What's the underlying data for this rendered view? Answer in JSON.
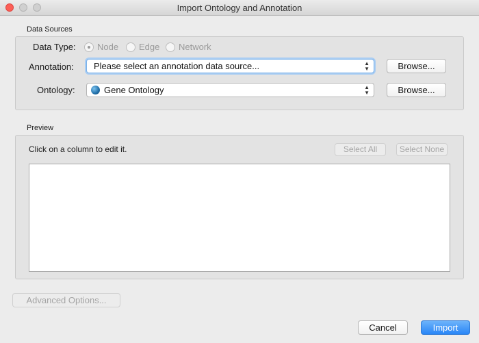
{
  "window": {
    "title": "Import Ontology and Annotation"
  },
  "data_sources": {
    "group_label": "Data Sources",
    "data_type_label": "Data Type:",
    "data_type_options": [
      "Node",
      "Edge",
      "Network"
    ],
    "data_type_selected": "Node",
    "annotation_label": "Annotation:",
    "annotation_value": "Please select an annotation data source...",
    "annotation_browse": "Browse...",
    "ontology_label": "Ontology:",
    "ontology_value": "Gene Ontology",
    "ontology_browse": "Browse..."
  },
  "preview": {
    "group_label": "Preview",
    "hint": "Click on a column to edit it.",
    "select_all": "Select All",
    "select_none": "Select None"
  },
  "footer": {
    "advanced": "Advanced Options...",
    "cancel": "Cancel",
    "import": "Import"
  },
  "colors": {
    "accent": "#2986f7",
    "close": "#fc5f57"
  },
  "icons": {
    "ontology": "globe-icon",
    "dropdown": "updown-arrows-icon"
  }
}
